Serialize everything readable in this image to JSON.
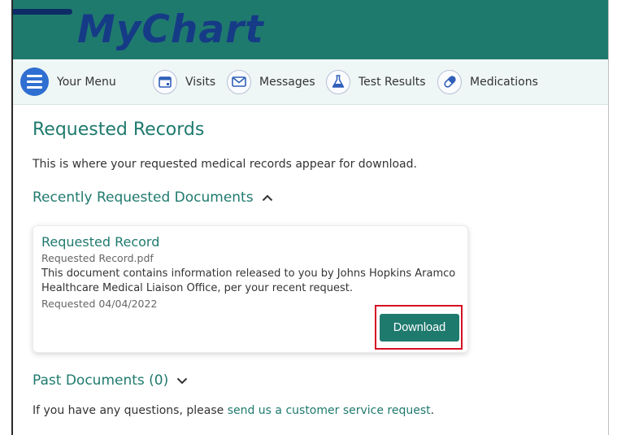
{
  "app": {
    "logo_text": "MyChart"
  },
  "nav": {
    "items": [
      {
        "label": "Your Menu",
        "icon": "hamburger-menu-icon"
      },
      {
        "label": "Visits",
        "icon": "calendar-icon"
      },
      {
        "label": "Messages",
        "icon": "envelope-icon"
      },
      {
        "label": "Test Results",
        "icon": "flask-icon"
      },
      {
        "label": "Medications",
        "icon": "pill-icon"
      }
    ]
  },
  "page": {
    "title": "Requested Records",
    "intro": "This is where your requested medical records appear for download."
  },
  "recent": {
    "heading": "Recently Requested Documents",
    "toggle_icon": "chevron-up-icon",
    "card": {
      "title": "Requested Record",
      "filename": "Requested Record.pdf",
      "description": "This document contains information released to you by Johns Hopkins Aramco Healthcare Medical Liaison Office, per your recent request.",
      "requested_date": "Requested 04/04/2022",
      "download_label": "Download"
    }
  },
  "past": {
    "heading": "Past Documents (0)",
    "toggle_icon": "chevron-down-icon"
  },
  "footer": {
    "text_before": "If you have any questions, please ",
    "link_text": "send us a customer service request",
    "text_after": "."
  },
  "colors": {
    "brand_teal": "#1f7a6e",
    "logo_blue": "#163b86",
    "menu_blue": "#2f6fd1",
    "highlight_red": "#d40f24"
  }
}
